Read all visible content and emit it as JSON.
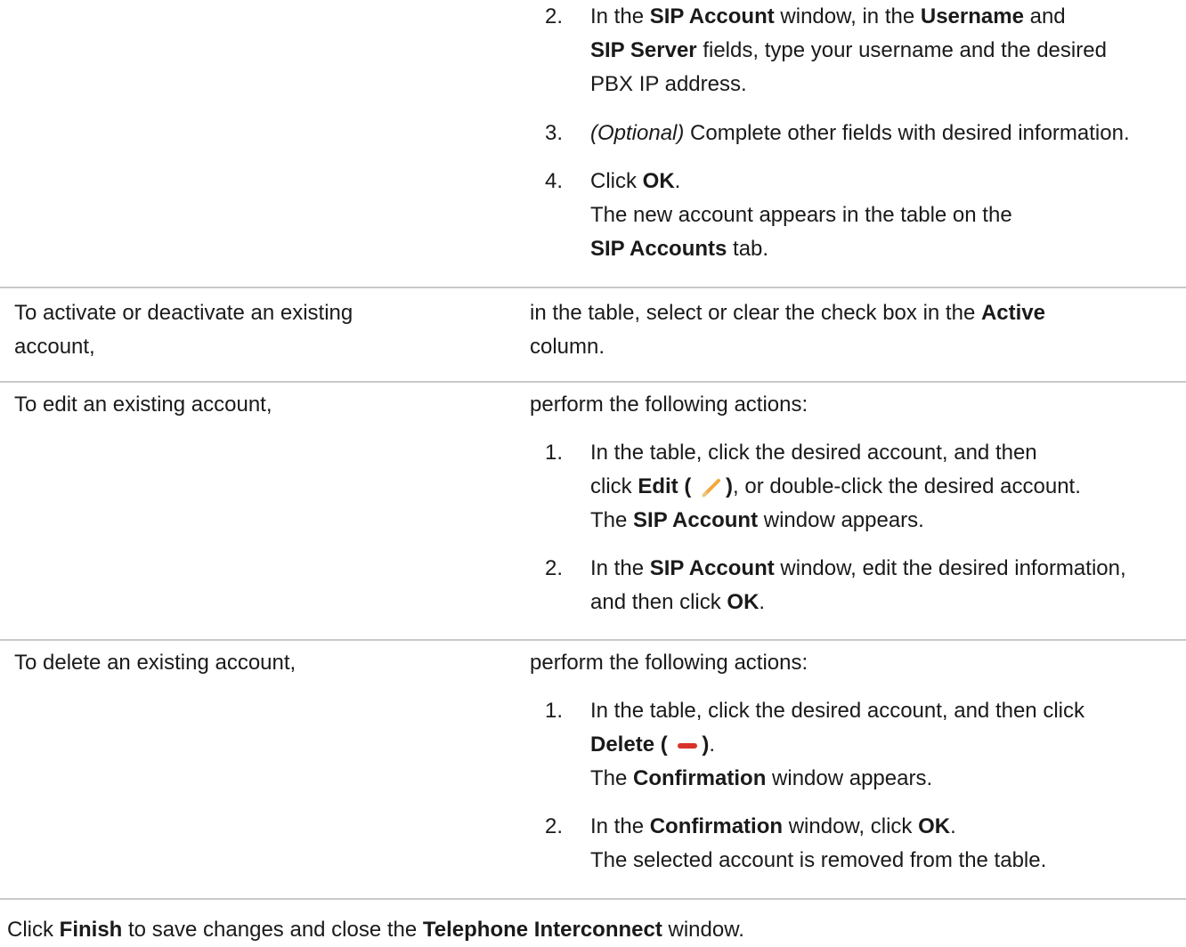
{
  "top_block": {
    "step2": {
      "num": "2.",
      "lines": [
        [
          "In the ",
          "SIP Account",
          " window, in the ",
          "Username",
          " and"
        ],
        [
          "SIP Server",
          " fields, type your username and the desired"
        ],
        [
          "PBX IP address."
        ]
      ]
    },
    "step3": {
      "num": "3.",
      "optional": "(Optional)",
      "text": " Complete other fields with desired information."
    },
    "step4": {
      "num": "4.",
      "click": "Click ",
      "ok": "OK",
      "dot": ".",
      "result_line1": "The new account appears in the table on the",
      "result_bold": "SIP Accounts",
      "result_tail": " tab."
    }
  },
  "row_activate": {
    "left_line1": "To activate or deactivate an existing",
    "left_line2": "account,",
    "right_line1_a": "in the table, select or clear the check box in the ",
    "right_line1_b": "Active",
    "right_line2": "column."
  },
  "row_edit": {
    "left": "To edit an existing account,",
    "right_intro": "perform the following actions:",
    "step1": {
      "num": "1.",
      "line1": "In the table, click the desired account, and then",
      "line2_a": "click ",
      "line2_b": "Edit (",
      "line2_c": ")",
      "line2_d": ", or double-click the desired account.",
      "line3_a": "The ",
      "line3_b": "SIP Account",
      "line3_c": " window appears."
    },
    "step2": {
      "num": "2.",
      "line1_a": "In the ",
      "line1_b": "SIP Account",
      "line1_c": " window, edit the desired information,",
      "line2_a": "and then click ",
      "line2_b": "OK",
      "line2_c": "."
    }
  },
  "row_delete": {
    "left": "To delete an existing account,",
    "right_intro": "perform the following actions:",
    "step1": {
      "num": "1.",
      "line1": "In the table, click the desired account, and then click",
      "line2_a": "Delete (",
      "line2_b": ")",
      "line2_c": ".",
      "line3_a": "The ",
      "line3_b": "Confirmation",
      "line3_c": " window appears."
    },
    "step2": {
      "num": "2.",
      "line1_a": "In the ",
      "line1_b": "Confirmation",
      "line1_c": " window, click ",
      "line1_d": "OK",
      "line1_e": ".",
      "line2": "The selected account is removed from the table."
    }
  },
  "footer": {
    "a": "Click ",
    "b": "Finish",
    "c": " to save changes and close the ",
    "d": "Telephone Interconnect",
    "e": " window."
  },
  "icons": {
    "edit": "pencil-icon",
    "delete": "minus-icon",
    "delete_color": "#d9322b",
    "edit_color": "#f2a93b"
  }
}
